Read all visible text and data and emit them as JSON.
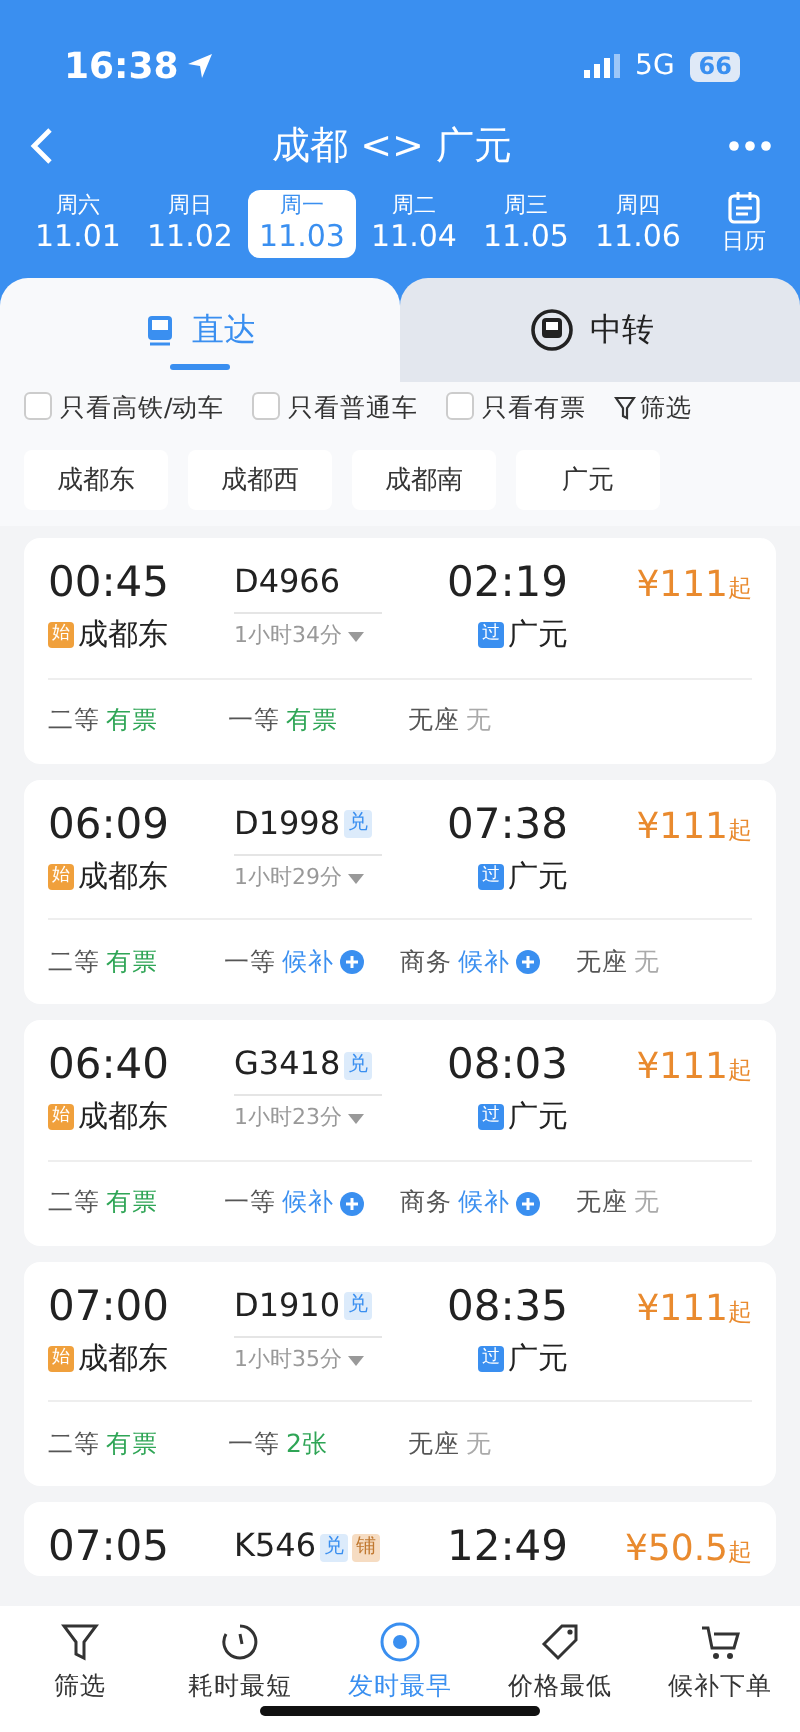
{
  "status_bar": {
    "time": "16:38",
    "network": "5G",
    "battery": "66"
  },
  "header": {
    "title": "成都 <> 广元"
  },
  "dates": [
    {
      "weekday": "周六",
      "date": "11.01",
      "selected": false
    },
    {
      "weekday": "周日",
      "date": "11.02",
      "selected": false
    },
    {
      "weekday": "周一",
      "date": "11.03",
      "selected": true
    },
    {
      "weekday": "周二",
      "date": "11.04",
      "selected": false
    },
    {
      "weekday": "周三",
      "date": "11.05",
      "selected": false
    },
    {
      "weekday": "周四",
      "date": "11.06",
      "selected": false
    }
  ],
  "calendar_label": "日历",
  "tabs": [
    {
      "label": "直达",
      "selected": true
    },
    {
      "label": "中转",
      "selected": false
    }
  ],
  "filters": [
    {
      "label": "只看高铁/动车",
      "checked": false
    },
    {
      "label": "只看普通车",
      "checked": false
    },
    {
      "label": "只看有票",
      "checked": false
    }
  ],
  "filter_button": "筛选",
  "stations": [
    "成都东",
    "成都西",
    "成都南",
    "广元"
  ],
  "trains": [
    {
      "depart": "00:45",
      "number": "D4966",
      "arrive": "02:19",
      "price": "¥111",
      "price_suffix": "起",
      "origin_tag": "始",
      "origin": "成都东",
      "duration": "1小时34分",
      "dest_tag": "过",
      "dest": "广元",
      "seats": [
        {
          "class": "二等",
          "status": "有票",
          "kind": "available"
        },
        {
          "class": "一等",
          "status": "有票",
          "kind": "available"
        },
        {
          "class": "无座",
          "status": "无",
          "kind": "none"
        }
      ]
    },
    {
      "depart": "06:09",
      "number": "D1998",
      "badges": [
        {
          "text": "兑",
          "kind": "exchange"
        }
      ],
      "arrive": "07:38",
      "price": "¥111",
      "price_suffix": "起",
      "origin_tag": "始",
      "origin": "成都东",
      "duration": "1小时29分",
      "dest_tag": "过",
      "dest": "广元",
      "seats": [
        {
          "class": "二等",
          "status": "有票",
          "kind": "available"
        },
        {
          "class": "一等",
          "status": "候补",
          "kind": "waitlist"
        },
        {
          "class": "商务",
          "status": "候补",
          "kind": "waitlist"
        },
        {
          "class": "无座",
          "status": "无",
          "kind": "none"
        }
      ]
    },
    {
      "depart": "06:40",
      "number": "G3418",
      "badges": [
        {
          "text": "兑",
          "kind": "exchange"
        }
      ],
      "arrive": "08:03",
      "price": "¥111",
      "price_suffix": "起",
      "origin_tag": "始",
      "origin": "成都东",
      "duration": "1小时23分",
      "dest_tag": "过",
      "dest": "广元",
      "seats": [
        {
          "class": "二等",
          "status": "有票",
          "kind": "available"
        },
        {
          "class": "一等",
          "status": "候补",
          "kind": "waitlist"
        },
        {
          "class": "商务",
          "status": "候补",
          "kind": "waitlist"
        },
        {
          "class": "无座",
          "status": "无",
          "kind": "none"
        }
      ]
    },
    {
      "depart": "07:00",
      "number": "D1910",
      "badges": [
        {
          "text": "兑",
          "kind": "exchange"
        }
      ],
      "arrive": "08:35",
      "price": "¥111",
      "price_suffix": "起",
      "origin_tag": "始",
      "origin": "成都东",
      "duration": "1小时35分",
      "dest_tag": "过",
      "dest": "广元",
      "seats": [
        {
          "class": "二等",
          "status": "有票",
          "kind": "available"
        },
        {
          "class": "一等",
          "status": "2张",
          "kind": "available"
        },
        {
          "class": "无座",
          "status": "无",
          "kind": "none"
        }
      ]
    },
    {
      "depart": "07:05",
      "number": "K546",
      "badges": [
        {
          "text": "兑",
          "kind": "exchange"
        },
        {
          "text": "铺",
          "kind": "berth"
        }
      ],
      "arrive": "12:49",
      "price": "¥50.5",
      "price_suffix": "起"
    }
  ],
  "bottom_nav": [
    {
      "label": "筛选",
      "kind": "filter",
      "selected": false
    },
    {
      "label": "耗时最短",
      "kind": "timer",
      "selected": false
    },
    {
      "label": "发时最早",
      "kind": "clock",
      "selected": true
    },
    {
      "label": "价格最低",
      "kind": "tag",
      "selected": false
    },
    {
      "label": "候补下单",
      "kind": "cart",
      "selected": false
    }
  ]
}
